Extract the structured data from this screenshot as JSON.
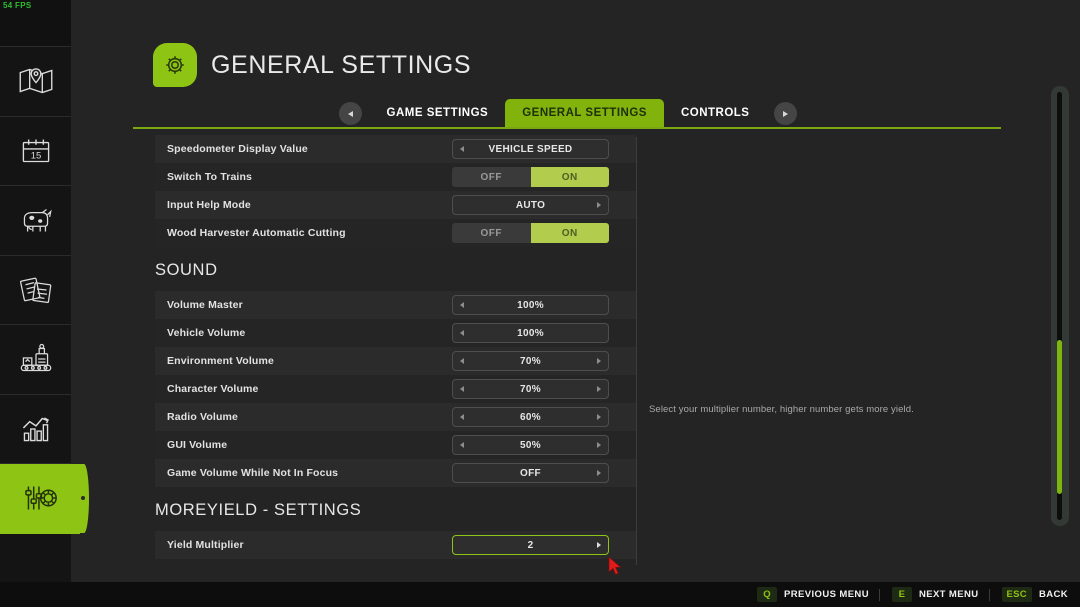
{
  "hud": {
    "fps": "54 FPS"
  },
  "sidebar": {
    "items": [
      {
        "name": "map",
        "icon": "map-icon",
        "active": false
      },
      {
        "name": "calendar",
        "icon": "calendar-icon",
        "active": false
      },
      {
        "name": "animals",
        "icon": "cow-icon",
        "active": false
      },
      {
        "name": "contracts",
        "icon": "documents-icon",
        "active": false
      },
      {
        "name": "production",
        "icon": "production-icon",
        "active": false
      },
      {
        "name": "statistics",
        "icon": "bar-chart-icon",
        "active": false
      },
      {
        "name": "settings",
        "icon": "settings-icon",
        "active": true
      }
    ]
  },
  "header": {
    "title": "GENERAL SETTINGS",
    "badge_icon": "gear-icon"
  },
  "tabs": {
    "prev_arrow": "chevron-left-icon",
    "next_arrow": "chevron-right-icon",
    "items": [
      {
        "label": "GAME SETTINGS",
        "active": false
      },
      {
        "label": "GENERAL SETTINGS",
        "active": true
      },
      {
        "label": "CONTROLS",
        "active": false
      }
    ]
  },
  "settings": [
    {
      "type": "rows",
      "rows": [
        {
          "label": "Speedometer Display Value",
          "control": "option",
          "value": "VEHICLE SPEED",
          "left_arrow": true,
          "right_arrow": false,
          "selected": false
        },
        {
          "label": "Switch To Trains",
          "control": "toggle",
          "off_label": "OFF",
          "on_label": "ON",
          "value": "ON",
          "selected": false
        },
        {
          "label": "Input Help Mode",
          "control": "option",
          "value": "AUTO",
          "left_arrow": false,
          "right_arrow": true,
          "selected": false
        },
        {
          "label": "Wood Harvester Automatic Cutting",
          "control": "toggle",
          "off_label": "OFF",
          "on_label": "ON",
          "value": "ON",
          "selected": false
        }
      ]
    },
    {
      "type": "section",
      "heading": "SOUND",
      "rows": [
        {
          "label": "Volume Master",
          "control": "option",
          "value": "100%",
          "left_arrow": true,
          "right_arrow": false,
          "selected": false
        },
        {
          "label": "Vehicle Volume",
          "control": "option",
          "value": "100%",
          "left_arrow": true,
          "right_arrow": false,
          "selected": false
        },
        {
          "label": "Environment Volume",
          "control": "option",
          "value": "70%",
          "left_arrow": true,
          "right_arrow": true,
          "selected": false
        },
        {
          "label": "Character Volume",
          "control": "option",
          "value": "70%",
          "left_arrow": true,
          "right_arrow": true,
          "selected": false
        },
        {
          "label": "Radio Volume",
          "control": "option",
          "value": "60%",
          "left_arrow": true,
          "right_arrow": true,
          "selected": false
        },
        {
          "label": "GUI Volume",
          "control": "option",
          "value": "50%",
          "left_arrow": true,
          "right_arrow": true,
          "selected": false
        },
        {
          "label": "Game Volume While Not In Focus",
          "control": "option",
          "value": "OFF",
          "left_arrow": false,
          "right_arrow": true,
          "selected": false
        }
      ]
    },
    {
      "type": "section",
      "heading": "MOREYIELD - SETTINGS",
      "rows": [
        {
          "label": "Yield Multiplier",
          "control": "option",
          "value": "2",
          "left_arrow": false,
          "right_arrow": true,
          "selected": true
        }
      ]
    }
  ],
  "help": {
    "text": "Select your multiplier number, higher number gets more yield."
  },
  "scrollbar": {
    "thumb_top_pct": 58,
    "thumb_height_pct": 36
  },
  "bottom_bar": {
    "hints": [
      {
        "key": "Q",
        "label": "PREVIOUS MENU"
      },
      {
        "key": "E",
        "label": "NEXT MENU"
      },
      {
        "key": "ESC",
        "label": "BACK"
      }
    ]
  },
  "colors": {
    "accent_green": "#8ec413",
    "tab_green": "#81b30c",
    "toggle_on": "#b2cd4e",
    "panel_bg": "#242424",
    "row_odd": "#2b2b2b",
    "row_even": "#252525"
  }
}
